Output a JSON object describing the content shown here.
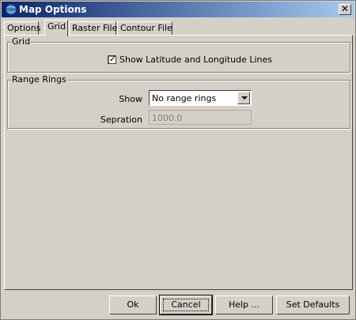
{
  "window": {
    "title": "Map Options"
  },
  "tabs": [
    {
      "label": "Options"
    },
    {
      "label": "Grid"
    },
    {
      "label": "Raster File"
    },
    {
      "label": "Contour File"
    }
  ],
  "active_tab": "Grid",
  "grid_group": {
    "title": "Grid",
    "latlon_checkbox": {
      "label": "Show Latitude and Longitude Lines",
      "checked": true
    }
  },
  "range_group": {
    "title": "Range Rings",
    "show_label": "Show",
    "show_value": "No range rings",
    "separation_label": "Sepration",
    "separation_value": "1000.0"
  },
  "buttons": {
    "ok": "Ok",
    "cancel": "Cancel",
    "help": "Help ...",
    "defaults": "Set Defaults"
  },
  "icons": {
    "app": "globe-icon",
    "close": "close-icon",
    "dropdown": "chevron-down-icon",
    "check": "checkmark-icon"
  }
}
